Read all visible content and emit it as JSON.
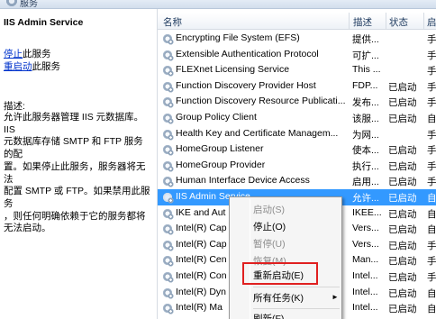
{
  "window": {
    "title": "服务"
  },
  "detail": {
    "service_title": "IIS Admin Service",
    "stop_link": "停止",
    "stop_suffix": "此服务",
    "restart_link": "重启动",
    "restart_suffix": "此服务",
    "desc_label": "描述:",
    "desc_lines": [
      "允许此服务器管理 IIS 元数据库。IIS",
      "元数据库存储 SMTP 和 FTP 服务的配",
      "置。如果停止此服务，服务器将无法",
      "配置 SMTP 或 FTP。如果禁用此服务",
      "，则任何明确依赖于它的服务都将",
      "无法启动。"
    ]
  },
  "list": {
    "headers": {
      "name": "名称",
      "desc": "描述",
      "status": "状态",
      "start": "启"
    },
    "rows": [
      {
        "name": "Encrypting File System (EFS)",
        "desc": "提供...",
        "status": "",
        "start": "手"
      },
      {
        "name": "Extensible Authentication Protocol",
        "desc": "可扩...",
        "status": "",
        "start": "手"
      },
      {
        "name": "FLEXnet Licensing Service",
        "desc": "This ...",
        "status": "",
        "start": "手"
      },
      {
        "name": "Function Discovery Provider Host",
        "desc": "FDP...",
        "status": "已启动",
        "start": "手"
      },
      {
        "name": "Function Discovery Resource Publicati...",
        "desc": "发布...",
        "status": "已启动",
        "start": "手"
      },
      {
        "name": "Group Policy Client",
        "desc": "该服...",
        "status": "已启动",
        "start": "自"
      },
      {
        "name": "Health Key and Certificate Managem...",
        "desc": "为网...",
        "status": "",
        "start": "手"
      },
      {
        "name": "HomeGroup Listener",
        "desc": "使本...",
        "status": "已启动",
        "start": "手"
      },
      {
        "name": "HomeGroup Provider",
        "desc": "执行...",
        "status": "已启动",
        "start": "手"
      },
      {
        "name": "Human Interface Device Access",
        "desc": "启用...",
        "status": "已启动",
        "start": "手"
      },
      {
        "name": "IIS Admin Service",
        "desc": "允许...",
        "status": "已启动",
        "start": "自",
        "selected": true
      },
      {
        "name": "IKE and Aut",
        "desc": "IKEE...",
        "status": "已启动",
        "start": "自"
      },
      {
        "name": "Intel(R) Cap",
        "desc": "Vers...",
        "status": "已启动",
        "start": "自"
      },
      {
        "name": "Intel(R) Cap",
        "desc": "Vers...",
        "status": "已启动",
        "start": "手"
      },
      {
        "name": "Intel(R) Cen",
        "desc": "Man...",
        "status": "已启动",
        "start": "手"
      },
      {
        "name": "Intel(R) Con",
        "desc": "Intel...",
        "status": "已启动",
        "start": "手"
      },
      {
        "name": "Intel(R) Dyn",
        "desc": "Intel...",
        "status": "已启动",
        "start": "自"
      },
      {
        "name": "Intel(R) Ma",
        "desc": "Intel...",
        "status": "已启动",
        "start": "自"
      }
    ]
  },
  "context_menu": {
    "items": [
      {
        "label": "启动(S)",
        "enabled": false
      },
      {
        "label": "停止(O)",
        "enabled": true
      },
      {
        "label": "暂停(U)",
        "enabled": false
      },
      {
        "label": "恢复(M)",
        "enabled": false
      },
      {
        "label": "重新启动(E)",
        "enabled": true,
        "highlighted": true
      },
      {
        "label": "所有任务(K)",
        "enabled": true,
        "submenu": true
      },
      {
        "label": "刷新(F)",
        "enabled": true
      }
    ],
    "submenu_arrow": "►",
    "highlight_color": "#e02020"
  },
  "colors": {
    "selection": "#3399ff",
    "link": "#0033cc"
  }
}
